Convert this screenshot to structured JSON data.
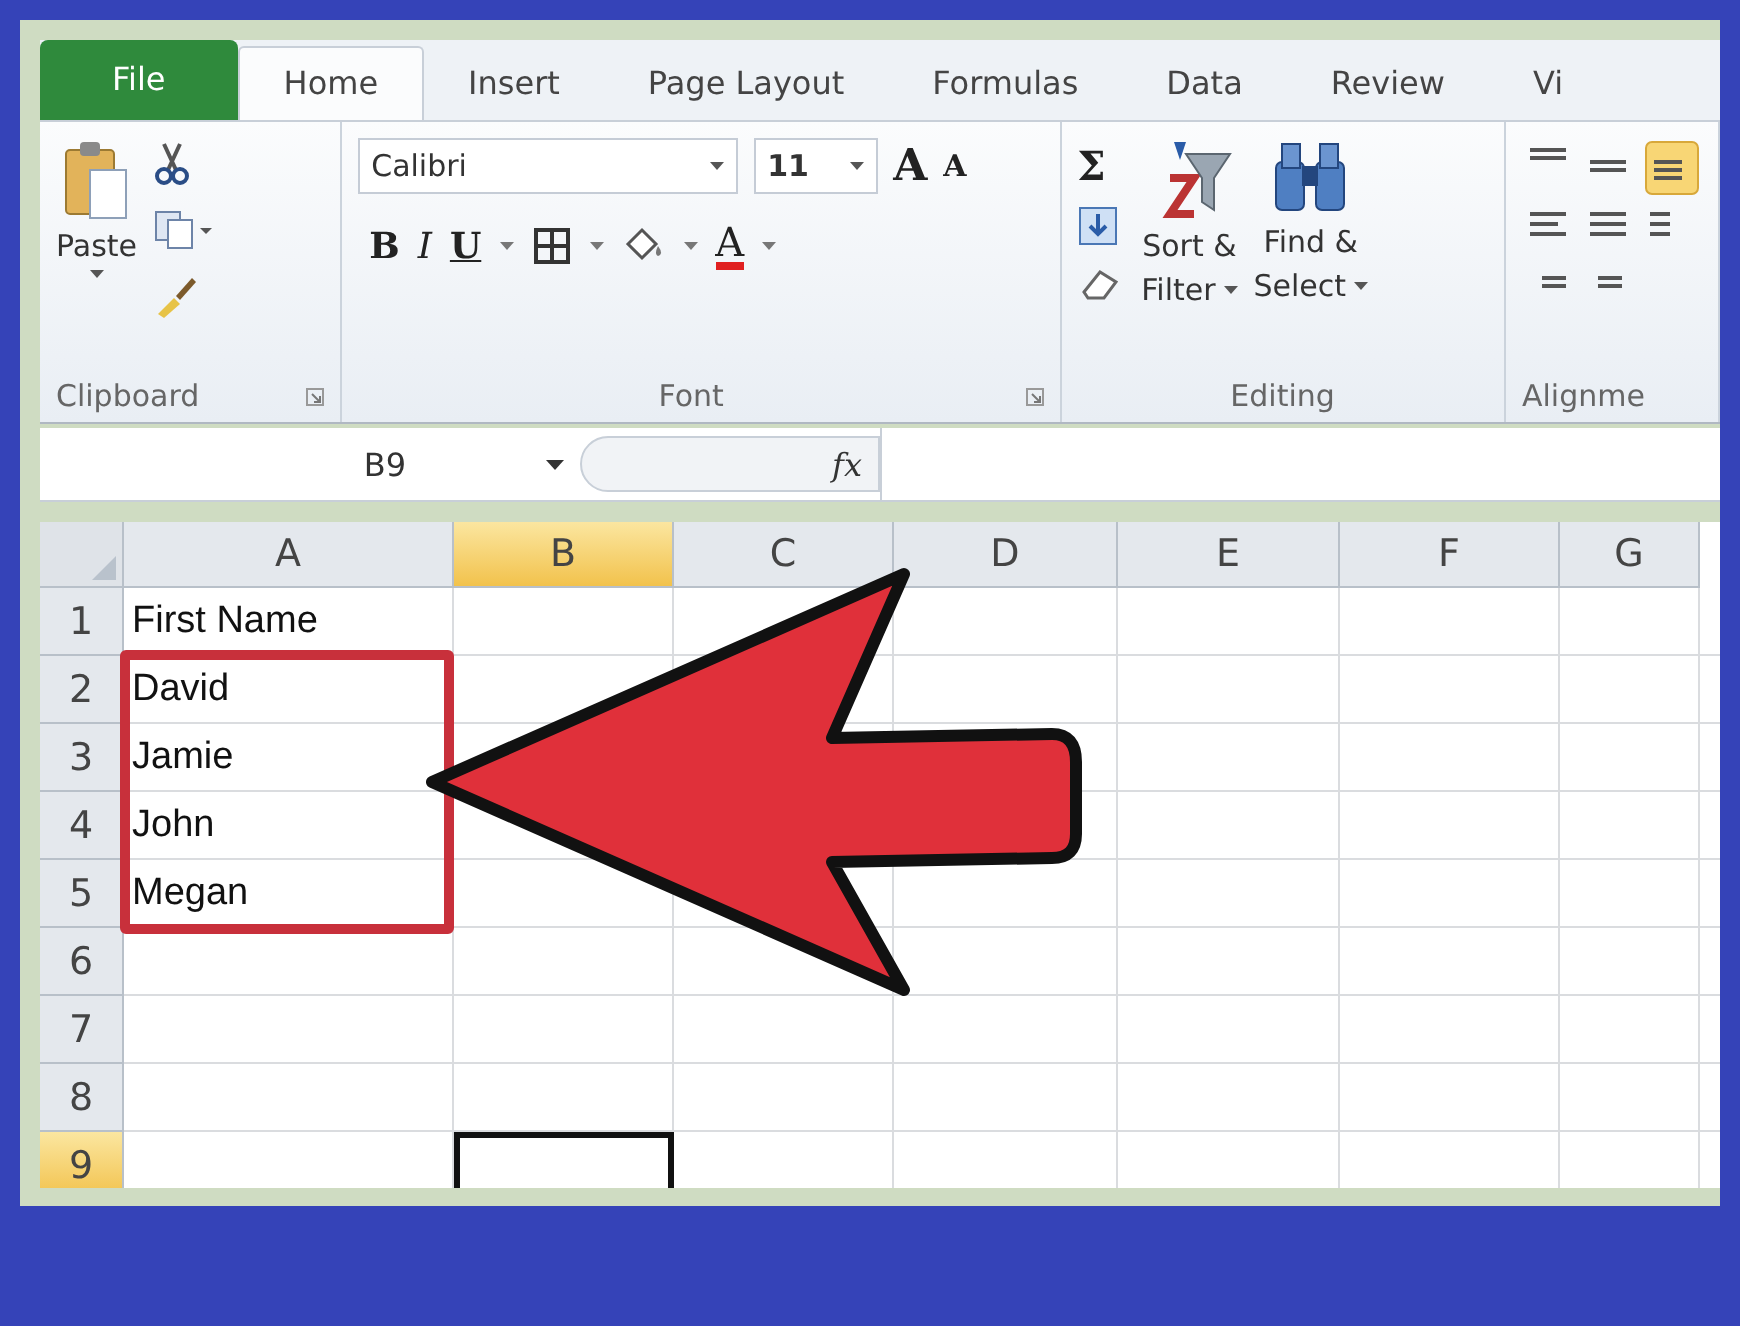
{
  "tabs": [
    {
      "label": "File",
      "kind": "file",
      "selected": false
    },
    {
      "label": "Home",
      "kind": "tab",
      "selected": true
    },
    {
      "label": "Insert",
      "kind": "tab",
      "selected": false
    },
    {
      "label": "Page Layout",
      "kind": "tab",
      "selected": false
    },
    {
      "label": "Formulas",
      "kind": "tab",
      "selected": false
    },
    {
      "label": "Data",
      "kind": "tab",
      "selected": false
    },
    {
      "label": "Review",
      "kind": "tab",
      "selected": false
    },
    {
      "label": "Vi",
      "kind": "tab",
      "selected": false
    }
  ],
  "ribbon": {
    "clipboard": {
      "paste": "Paste",
      "label": "Clipboard"
    },
    "font": {
      "name": "Calibri",
      "size": "11",
      "grow": "A",
      "shrink": "A",
      "bold": "B",
      "italic": "I",
      "underline": "U",
      "font_color_letter": "A",
      "label": "Font"
    },
    "editing": {
      "sum": "Σ",
      "sort": [
        "Sort &",
        "Filter"
      ],
      "find": [
        "Find &",
        "Select"
      ],
      "label": "Editing"
    },
    "alignment": {
      "label": "Alignme"
    }
  },
  "formula_bar": {
    "name_box": "B9",
    "fx": "fx"
  },
  "grid": {
    "columns": [
      {
        "label": "A",
        "selected": false
      },
      {
        "label": "B",
        "selected": true
      },
      {
        "label": "C",
        "selected": false
      },
      {
        "label": "D",
        "selected": false
      },
      {
        "label": "E",
        "selected": false
      },
      {
        "label": "F",
        "selected": false
      },
      {
        "label": "G",
        "selected": false
      }
    ],
    "rows": [
      {
        "number": "1",
        "selected": false,
        "values": [
          "First Name"
        ]
      },
      {
        "number": "2",
        "selected": false,
        "values": [
          "David"
        ]
      },
      {
        "number": "3",
        "selected": false,
        "values": [
          "Jamie"
        ]
      },
      {
        "number": "4",
        "selected": false,
        "values": [
          "John"
        ]
      },
      {
        "number": "5",
        "selected": false,
        "values": [
          "Megan"
        ]
      },
      {
        "number": "6",
        "selected": false,
        "values": []
      },
      {
        "number": "7",
        "selected": false,
        "values": []
      },
      {
        "number": "8",
        "selected": false,
        "values": []
      },
      {
        "number": "9",
        "selected": true,
        "values": []
      }
    ]
  },
  "annotations": [
    {
      "kind": "highlight-box"
    },
    {
      "kind": "arrow"
    }
  ]
}
